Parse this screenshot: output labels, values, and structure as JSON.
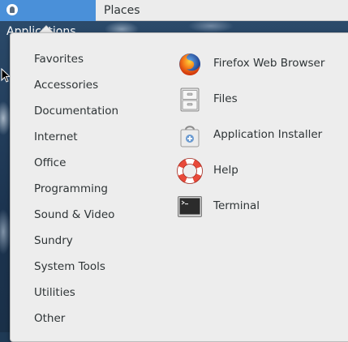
{
  "topbar": {
    "applications_label": "Applications",
    "places_label": "Places"
  },
  "categories": [
    {
      "label": "Favorites"
    },
    {
      "label": "Accessories"
    },
    {
      "label": "Documentation"
    },
    {
      "label": "Internet"
    },
    {
      "label": "Office"
    },
    {
      "label": "Programming"
    },
    {
      "label": "Sound & Video"
    },
    {
      "label": "Sundry"
    },
    {
      "label": "System Tools"
    },
    {
      "label": "Utilities"
    },
    {
      "label": "Other"
    }
  ],
  "apps": [
    {
      "label": "Firefox Web Browser",
      "icon": "firefox-icon"
    },
    {
      "label": "Files",
      "icon": "file-cabinet-icon"
    },
    {
      "label": "Application Installer",
      "icon": "shopping-bag-icon"
    },
    {
      "label": "Help",
      "icon": "lifebuoy-icon"
    },
    {
      "label": "Terminal",
      "icon": "terminal-icon"
    }
  ],
  "colors": {
    "topbar_bg": "#ececec",
    "applications_active_bg": "#4a90d9",
    "popup_bg": "#ededed",
    "text": "#2e3436"
  }
}
